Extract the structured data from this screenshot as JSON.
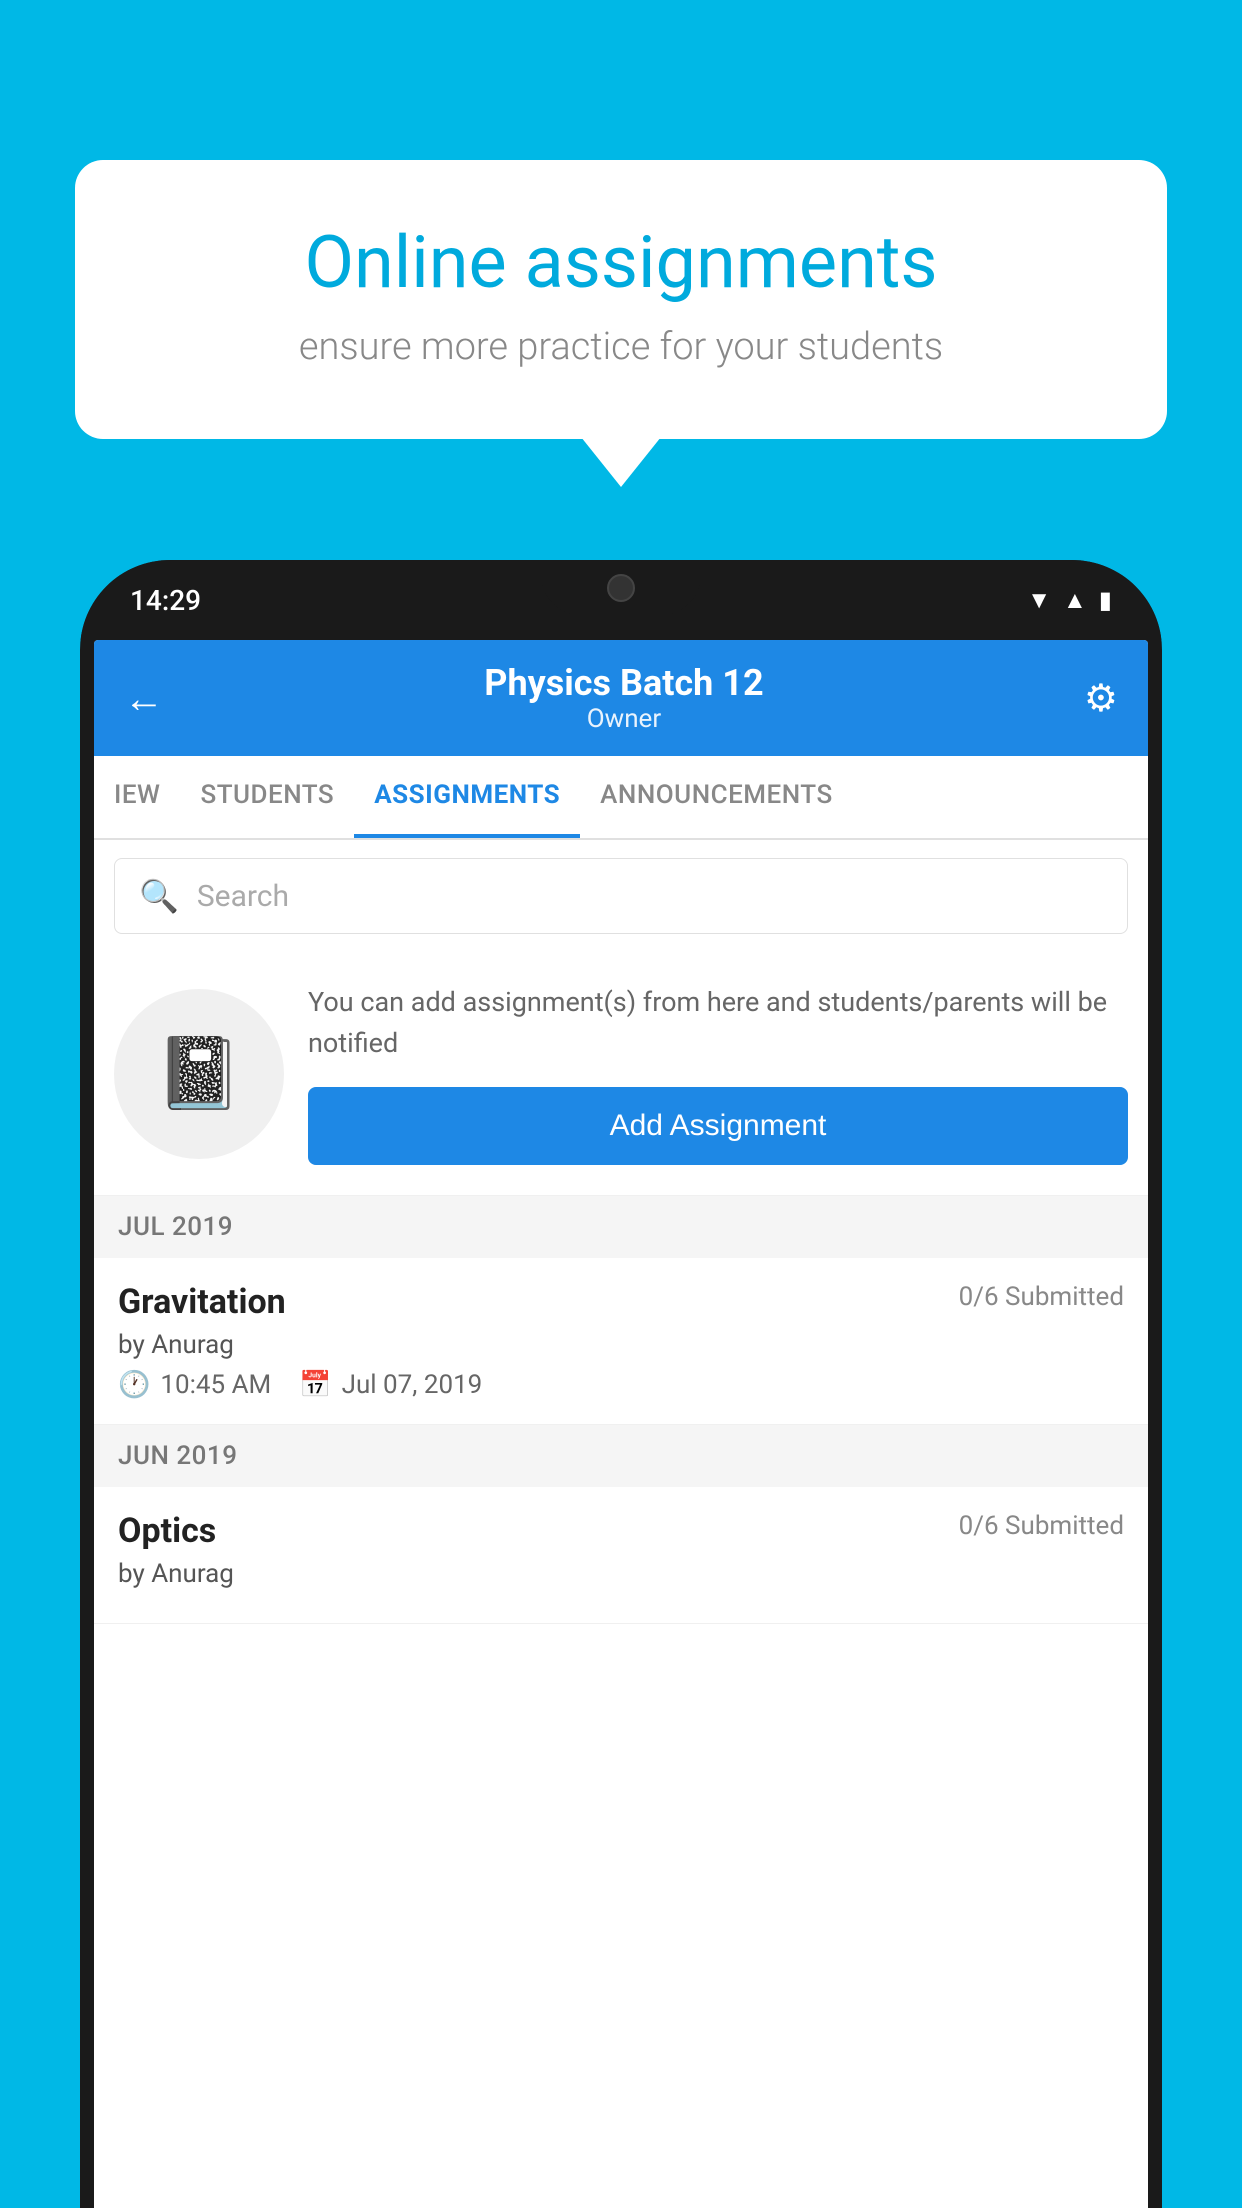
{
  "background_color": "#00B8E6",
  "speech_bubble": {
    "title": "Online assignments",
    "subtitle": "ensure more practice for your students"
  },
  "status_bar": {
    "time": "14:29",
    "icons": [
      "wifi",
      "signal",
      "battery"
    ]
  },
  "header": {
    "title": "Physics Batch 12",
    "subtitle": "Owner",
    "back_label": "←",
    "settings_label": "⚙"
  },
  "tabs": [
    {
      "label": "IEW",
      "active": false
    },
    {
      "label": "STUDENTS",
      "active": false
    },
    {
      "label": "ASSIGNMENTS",
      "active": true
    },
    {
      "label": "ANNOUNCEMENTS",
      "active": false
    }
  ],
  "search": {
    "placeholder": "Search"
  },
  "empty_state": {
    "description": "You can add assignment(s) from here and students/parents will be notified",
    "button_label": "Add Assignment"
  },
  "months": [
    {
      "label": "JUL 2019",
      "assignments": [
        {
          "name": "Gravitation",
          "submitted": "0/6 Submitted",
          "by": "by Anurag",
          "time": "10:45 AM",
          "date": "Jul 07, 2019"
        }
      ]
    },
    {
      "label": "JUN 2019",
      "assignments": [
        {
          "name": "Optics",
          "submitted": "0/6 Submitted",
          "by": "by Anurag",
          "time": "",
          "date": ""
        }
      ]
    }
  ]
}
